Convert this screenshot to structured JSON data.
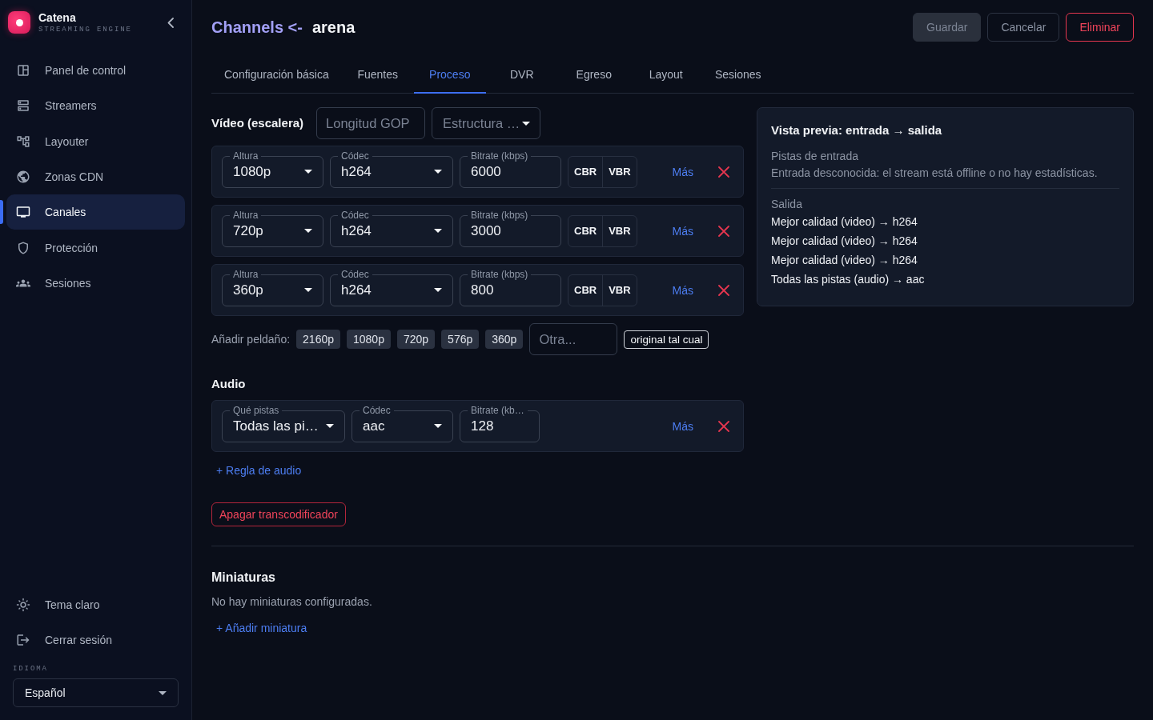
{
  "sidebar": {
    "brand": {
      "name": "Catena",
      "tagline": "STREAMING ENGINE"
    },
    "nav_items": [
      {
        "label": "Panel de control",
        "selected": false
      },
      {
        "label": "Streamers",
        "selected": false
      },
      {
        "label": "Layouter",
        "selected": false
      },
      {
        "label": "Zonas CDN",
        "selected": false
      },
      {
        "label": "Canales",
        "selected": true
      },
      {
        "label": "Protección",
        "selected": false
      },
      {
        "label": "Sesiones",
        "selected": false
      }
    ],
    "footer_items": [
      {
        "label": "Tema claro"
      },
      {
        "label": "Cerrar sesión"
      }
    ],
    "language": {
      "label": "IDIOMA",
      "value": "Español"
    }
  },
  "header": {
    "breadcrumb": "Channels <-",
    "title": "arena",
    "buttons": [
      {
        "label": "Guardar",
        "kind": "primary",
        "disabled": true
      },
      {
        "label": "Cancelar",
        "kind": "outline",
        "disabled": false
      },
      {
        "label": "Eliminar",
        "kind": "danger",
        "disabled": false
      }
    ]
  },
  "tabs": [
    {
      "label": "Configuración básica",
      "selected": false
    },
    {
      "label": "Fuentes",
      "selected": false
    },
    {
      "label": "Proceso",
      "selected": true
    },
    {
      "label": "DVR",
      "selected": false
    },
    {
      "label": "Egreso",
      "selected": false
    },
    {
      "label": "Layout",
      "selected": false
    },
    {
      "label": "Sesiones",
      "selected": false
    }
  ],
  "video": {
    "title": "Vídeo (escalera)",
    "gop": {
      "placeholder": "Longitud GOP"
    },
    "structure": {
      "placeholder": "Estructura …"
    },
    "rungs": [
      {
        "fields": [
          {
            "label": "Altura",
            "value": "1080p",
            "kind": "select"
          },
          {
            "label": "Códec",
            "value": "h264",
            "kind": "select"
          },
          {
            "label": "Bitrate (kbps)",
            "value": "6000",
            "kind": "input"
          }
        ],
        "modes": [
          "CBR",
          "VBR"
        ],
        "more": "Más"
      },
      {
        "fields": [
          {
            "label": "Altura",
            "value": "720p",
            "kind": "select"
          },
          {
            "label": "Códec",
            "value": "h264",
            "kind": "select"
          },
          {
            "label": "Bitrate (kbps)",
            "value": "3000",
            "kind": "input"
          }
        ],
        "modes": [
          "CBR",
          "VBR"
        ],
        "more": "Más"
      },
      {
        "fields": [
          {
            "label": "Altura",
            "value": "360p",
            "kind": "select"
          },
          {
            "label": "Códec",
            "value": "h264",
            "kind": "select"
          },
          {
            "label": "Bitrate (kbps)",
            "value": "800",
            "kind": "input"
          }
        ],
        "modes": [
          "CBR",
          "VBR"
        ],
        "more": "Más"
      }
    ],
    "add_rung": {
      "label": "Añadir peldaño:",
      "presets": [
        "2160p",
        "1080p",
        "720p",
        "576p",
        "360p"
      ],
      "custom": {
        "placeholder": "Otra..."
      },
      "original": "original tal cual"
    }
  },
  "audio": {
    "title": "Audio",
    "rules": [
      {
        "fields": [
          {
            "label": "Qué pistas",
            "value": "Todas las pi…",
            "kind": "select"
          },
          {
            "label": "Códec",
            "value": "aac",
            "kind": "select"
          },
          {
            "label": "Bitrate (kb…",
            "value": "128",
            "kind": "input"
          }
        ],
        "more": "Más"
      }
    ],
    "add_rule": "+ Regla de audio"
  },
  "transcoder_button": "Apagar transcodificador",
  "thumbnails": {
    "title": "Miniaturas",
    "empty": "No hay miniaturas configuradas.",
    "add": "+ Añadir miniatura"
  },
  "preview": {
    "title": "Vista previa: entrada → salida",
    "input_title": "Pistas de entrada",
    "input_text": "Entrada desconocida: el stream está offline o no hay estadísticas.",
    "output_title": "Salida",
    "outputs": [
      "Mejor calidad (video) → h264",
      "Mejor calidad (video) → h264",
      "Mejor calidad (video) → h264",
      "Todas las pistas (audio) → aac"
    ]
  }
}
